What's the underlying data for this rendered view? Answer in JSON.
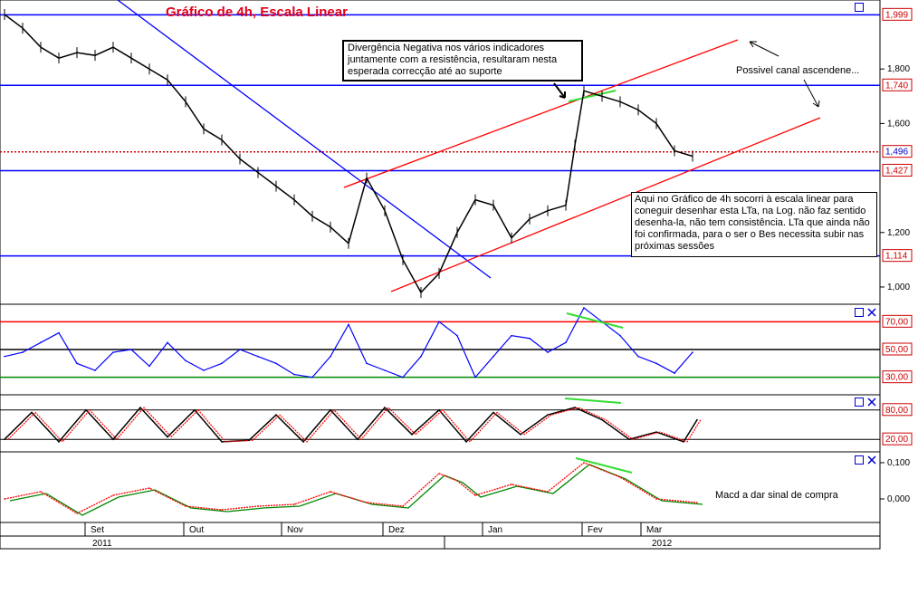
{
  "title": "Gráfico de 4h, Escala Linear",
  "colors": {
    "price_line": "#0000dd",
    "trend_red": "#ff0000",
    "trend_blue": "#0000ff",
    "rsi": "#0000ff",
    "stoch_main": "#000000",
    "stoch_signal": "#ff0000",
    "macd": "#ff0000",
    "macd_signal": "#008800",
    "highlight_green": "#33dd33",
    "dashed_price": "#cc0000"
  },
  "annotations": {
    "divergence": "Divergência Negativa nos vários indicadores juntamente com a resistência, resultaram nesta esperada correcção até ao suporte",
    "channel": "Possivel canal ascendene...",
    "linear_note": "Aqui no Gráfico de 4h socorri à escala linear para coneguir desenhar esta LTa, na Log. não faz sentido desenha-la, não tem consistência. LTa que ainda não foi confirmada, para o ser o Bes necessita subir nas próximas sessões",
    "macd_note": "Macd a dar sinal de compra"
  },
  "axis": {
    "months": [
      "Set",
      "Out",
      "Nov",
      "Dez",
      "Jan",
      "Fev",
      "Mar"
    ],
    "years": [
      "2011",
      "2012"
    ]
  },
  "chart_data": [
    {
      "type": "line",
      "name": "price",
      "ylim": [
        0.95,
        2.04
      ],
      "y_ticks": [
        "1,800",
        "1,600",
        "1,200",
        "1,000"
      ],
      "levels": [
        "1,999",
        "1,740",
        "1,496",
        "1,427",
        "1,114"
      ],
      "level_values": [
        1.999,
        1.74,
        1.496,
        1.427,
        1.114
      ],
      "x": [
        0,
        20,
        40,
        60,
        80,
        100,
        120,
        140,
        160,
        180,
        200,
        220,
        240,
        260,
        280,
        300,
        320,
        340,
        360,
        380,
        400,
        420,
        440,
        460,
        480,
        500,
        520,
        540,
        560,
        580,
        600,
        620,
        630,
        640,
        660,
        680,
        700,
        720,
        740,
        760
      ],
      "values": [
        2.0,
        1.95,
        1.88,
        1.84,
        1.86,
        1.85,
        1.88,
        1.84,
        1.8,
        1.76,
        1.68,
        1.58,
        1.54,
        1.47,
        1.42,
        1.37,
        1.32,
        1.26,
        1.22,
        1.16,
        1.4,
        1.28,
        1.1,
        0.98,
        1.05,
        1.2,
        1.32,
        1.3,
        1.18,
        1.25,
        1.28,
        1.3,
        1.52,
        1.72,
        1.7,
        1.68,
        1.65,
        1.6,
        1.5,
        1.48
      ]
    },
    {
      "type": "line",
      "name": "rsi",
      "ylim": [
        20,
        80
      ],
      "y_ticks": [
        "70,00",
        "50,00",
        "30,00"
      ],
      "x": [
        0,
        20,
        40,
        60,
        80,
        100,
        120,
        140,
        160,
        180,
        200,
        220,
        240,
        260,
        280,
        300,
        320,
        340,
        360,
        380,
        400,
        420,
        440,
        460,
        480,
        500,
        520,
        540,
        560,
        580,
        600,
        620,
        640,
        660,
        680,
        700,
        720,
        740,
        760
      ],
      "values": [
        45,
        48,
        55,
        62,
        40,
        35,
        48,
        50,
        38,
        55,
        42,
        35,
        40,
        50,
        45,
        40,
        32,
        30,
        45,
        68,
        40,
        35,
        30,
        45,
        70,
        60,
        30,
        45,
        60,
        58,
        48,
        55,
        80,
        70,
        60,
        45,
        40,
        33,
        48
      ]
    },
    {
      "type": "line",
      "name": "stochastic",
      "ylim": [
        0,
        100
      ],
      "y_ticks": [
        "80,00",
        "20,00"
      ],
      "x": [
        0,
        30,
        60,
        90,
        120,
        150,
        180,
        210,
        240,
        270,
        300,
        330,
        360,
        390,
        420,
        450,
        480,
        510,
        540,
        570,
        600,
        630,
        660,
        690,
        720,
        750,
        765
      ],
      "values": [
        20,
        75,
        15,
        80,
        20,
        85,
        25,
        80,
        15,
        18,
        70,
        15,
        80,
        20,
        85,
        30,
        80,
        15,
        75,
        30,
        70,
        85,
        60,
        20,
        35,
        15,
        60
      ]
    },
    {
      "type": "line",
      "name": "macd",
      "ylim": [
        -0.06,
        0.12
      ],
      "y_ticks": [
        "0,100",
        "0,000"
      ],
      "x": [
        0,
        40,
        80,
        120,
        160,
        200,
        240,
        280,
        320,
        360,
        400,
        440,
        480,
        500,
        520,
        560,
        600,
        640,
        680,
        720,
        765
      ],
      "values": [
        0.0,
        0.02,
        -0.04,
        0.01,
        0.03,
        -0.02,
        -0.03,
        -0.02,
        -0.015,
        0.02,
        -0.01,
        -0.02,
        0.07,
        0.05,
        0.01,
        0.04,
        0.02,
        0.1,
        0.06,
        0.0,
        -0.01
      ]
    }
  ]
}
